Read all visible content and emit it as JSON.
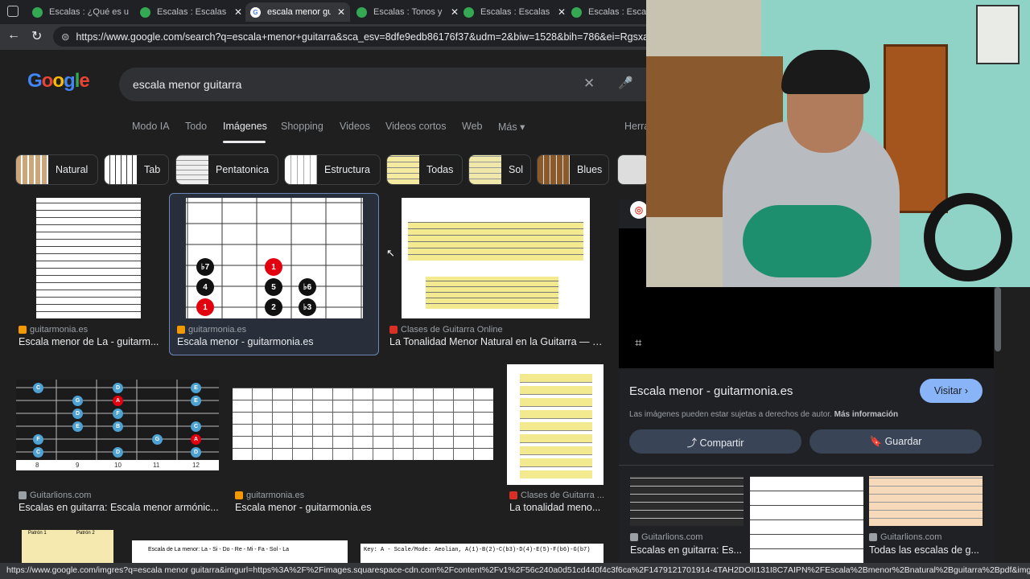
{
  "browser": {
    "tabs": [
      {
        "title": "Escalas : ¿Qué es u",
        "active": false
      },
      {
        "title": "Escalas : Escalas m",
        "active": false
      },
      {
        "title": "escala menor guita",
        "active": true
      },
      {
        "title": "Escalas : Tonos y s",
        "active": false
      },
      {
        "title": "Escalas : Escalas re",
        "active": false
      },
      {
        "title": "Escalas : Escalas",
        "active": false
      }
    ],
    "url": "https://www.google.com/search?q=escala+menor+guitarra&sca_esv=8dfe9edb86176f37&udm=2&biw=1528&bih=786&ei=Rgsxaaj-Ge2",
    "status_url": "https://www.google.com/imgres?q=escala menor guitarra&imgurl=https%3A%2F%2Fimages.squarespace-cdn.com%2Fcontent%2Fv1%2F56c240a0d51cd440f4c3f6ca%2F1479121701914-4TAH2DOII131I8C7AIPN%2FEscala%2Bmenor%2Bnatural%2Bguitarra%2Bpdf&imgrefurl=htt..."
  },
  "google": {
    "logo": [
      "G",
      "o",
      "o",
      "g",
      "l",
      "e"
    ],
    "query": "escala menor guitarra",
    "nav": [
      "Modo IA",
      "Todo",
      "Imágenes",
      "Shopping",
      "Videos",
      "Videos cortos",
      "Web",
      "Más ▾",
      "Herra"
    ],
    "chips": [
      "Natural",
      "Tab",
      "Pentatonica",
      "Estructura",
      "Todas",
      "Sol",
      "Blues"
    ]
  },
  "results": [
    {
      "source": "guitarmonia.es",
      "title": "Escala menor de La - guitarm..."
    },
    {
      "source": "guitarmonia.es",
      "title": "Escala menor - guitarmonia.es"
    },
    {
      "source": "Clases de Guitarra Online",
      "title": "La Tonalidad Menor Natural en la Guitarra — C..."
    },
    {
      "source": "Guitarlions.com",
      "title": "Escalas en guitarra: Escala menor armónic..."
    },
    {
      "source": "guitarmonia.es",
      "title": "Escala menor - guitarmonia.es"
    },
    {
      "source": "Clases de Guitarra ...",
      "title": "La tonalidad meno..."
    }
  ],
  "row3": {
    "label_a": "Patrón 1",
    "label_b": "Patrón 2",
    "label_c": "Escala de La menor: La - Si - Do - Re - Mi - Fa - Sol - La",
    "label_d": "Key: A - Scale/Mode: Aeolian, A(1)-B(2)-C(b3)-D(4)-E(5)-F(b6)-G(b7)"
  },
  "panel": {
    "title": "Escala menor - guitarmonia.es",
    "visit": "Visitar ›",
    "copyright": "Las imágenes pueden estar sujetas a derechos de autor.",
    "more_info": "Más información",
    "share": "⤴ Compartir",
    "save": "🔖 Guardar",
    "related": [
      {
        "source": "Guitarlions.com",
        "title": "Escalas en guitarra: Es..."
      },
      {
        "source": "",
        "title": ""
      },
      {
        "source": "Guitarlions.com",
        "title": "Todas las escalas de g..."
      }
    ]
  },
  "fretboard_main": {
    "notes": [
      "♭7",
      "1",
      "4",
      "5",
      "♭6",
      "1",
      "2",
      "♭3"
    ]
  },
  "fretboard_dark": {
    "notes": [
      "C",
      "D",
      "E",
      "G",
      "A",
      "E",
      "D",
      "E",
      "F",
      "B",
      "C",
      "F",
      "A",
      "D",
      "C",
      "D",
      "G"
    ],
    "frets": [
      "8",
      "9",
      "10",
      "11",
      "12"
    ]
  },
  "colors": {
    "accent": "#8ab4f8",
    "red_note": "#e3000f",
    "black_note": "#111111",
    "blue_note": "#4ea1d3"
  }
}
